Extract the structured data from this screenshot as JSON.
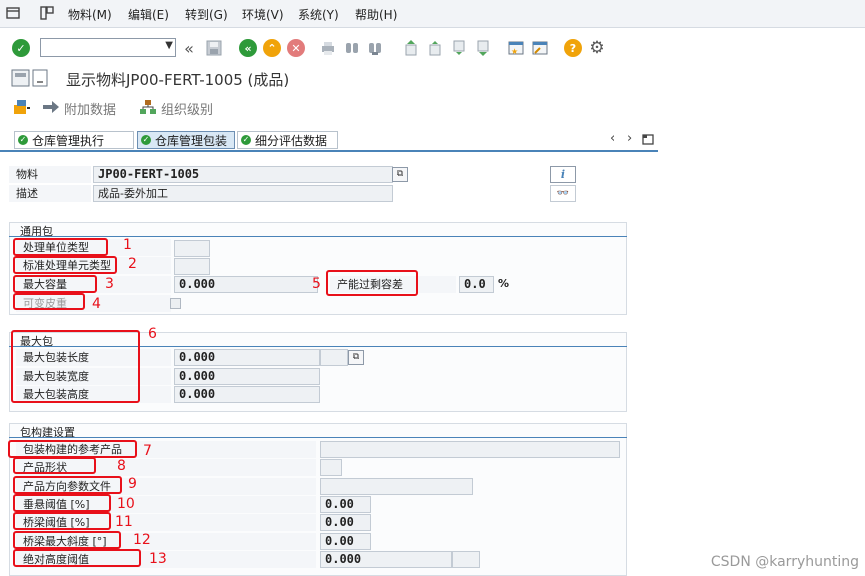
{
  "menu": {
    "items": [
      "物料(M)",
      "编辑(E)",
      "转到(G)",
      "环境(V)",
      "系统(Y)",
      "帮助(H)"
    ]
  },
  "title": "显示物料JP00-FERT-1005 (成品)",
  "app_toolbar": {
    "additional_data": "附加数据",
    "org_levels": "组织级别"
  },
  "tabs": [
    "仓库管理执行",
    "仓库管理包装",
    "细分评估数据"
  ],
  "header": {
    "material_label": "物料",
    "material_value": "JP00-FERT-1005",
    "desc_label": "描述",
    "desc_value": "成品-委外加工"
  },
  "general_pack": {
    "title": "通用包",
    "handling_unit_type": "处理单位类型",
    "std_hu_type": "标准处理单元类型",
    "max_capacity": "最大容量",
    "max_capacity_value": "0.000",
    "variable_tare": "可变皮重",
    "overcapacity_tolerance": "产能过剩容差",
    "overcapacity_value": "0.0",
    "percent": "%"
  },
  "max_pack": {
    "title": "最大包",
    "length": "最大包装长度",
    "length_value": "0.000",
    "width": "最大包装宽度",
    "width_value": "0.000",
    "height": "最大包装高度",
    "height_value": "0.000"
  },
  "pack_build": {
    "title": "包构建设置",
    "ref_product": "包装构建的参考产品",
    "product_shape": "产品形状",
    "orientation_profile": "产品方向参数文件",
    "overhang_threshold": "垂悬阈值 [%]",
    "overhang_value": "0.00",
    "bridge_threshold": "桥梁阈值 [%]",
    "bridge_value": "0.00",
    "bridge_max_slope": "桥梁最大斜度 [°]",
    "slope_value": "0.00",
    "abs_height_threshold": "绝对高度阈值",
    "abs_height_value": "0.000"
  },
  "annotations": [
    "1",
    "2",
    "3",
    "4",
    "5",
    "6",
    "7",
    "8",
    "9",
    "10",
    "11",
    "12",
    "13"
  ],
  "watermark": "CSDN @karryhunting",
  "colors": {
    "accent": "#4a83b8",
    "annotation": "#e8101a",
    "ok_green": "#2e9a3a",
    "help_orange": "#f0a30a"
  }
}
